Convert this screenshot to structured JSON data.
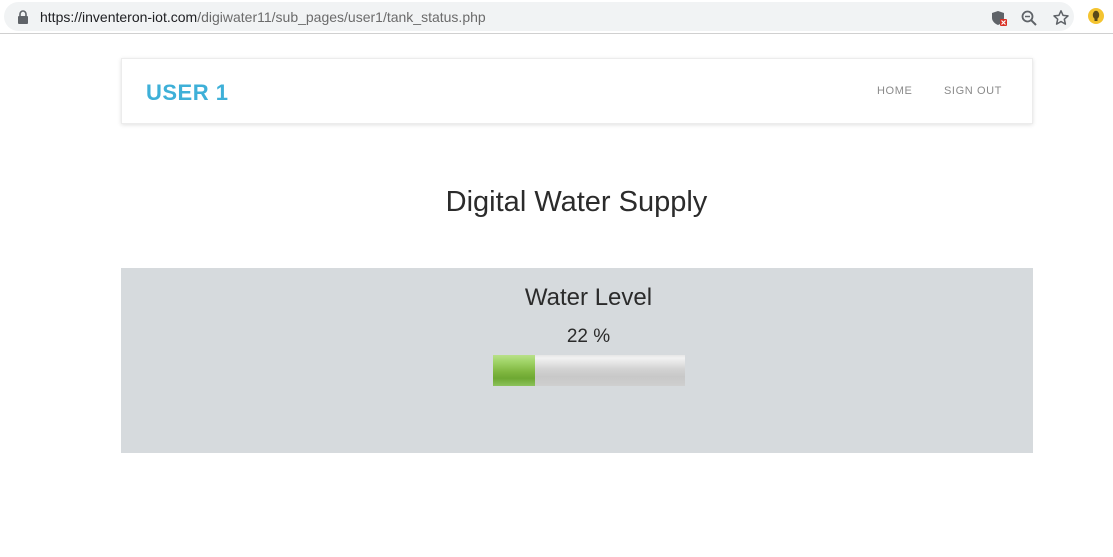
{
  "browser": {
    "url_host": "https://inventeron-iot.com",
    "url_path": "/digiwater11/sub_pages/user1/tank_status.php",
    "icons": [
      "lock-icon",
      "shield-blocked-icon",
      "zoom-icon",
      "star-icon",
      "extension-icon"
    ]
  },
  "navbar": {
    "brand": "USER 1",
    "links": [
      {
        "label": "HOME"
      },
      {
        "label": "SIGN OUT"
      }
    ],
    "brand_color": "#3eb0d8"
  },
  "main": {
    "title": "Digital Water Supply"
  },
  "water_panel": {
    "title": "Water Level",
    "level_text": "22 %",
    "level_percent": 22,
    "panel_color": "#d6dadd",
    "fill_color": "#7fb63f"
  }
}
